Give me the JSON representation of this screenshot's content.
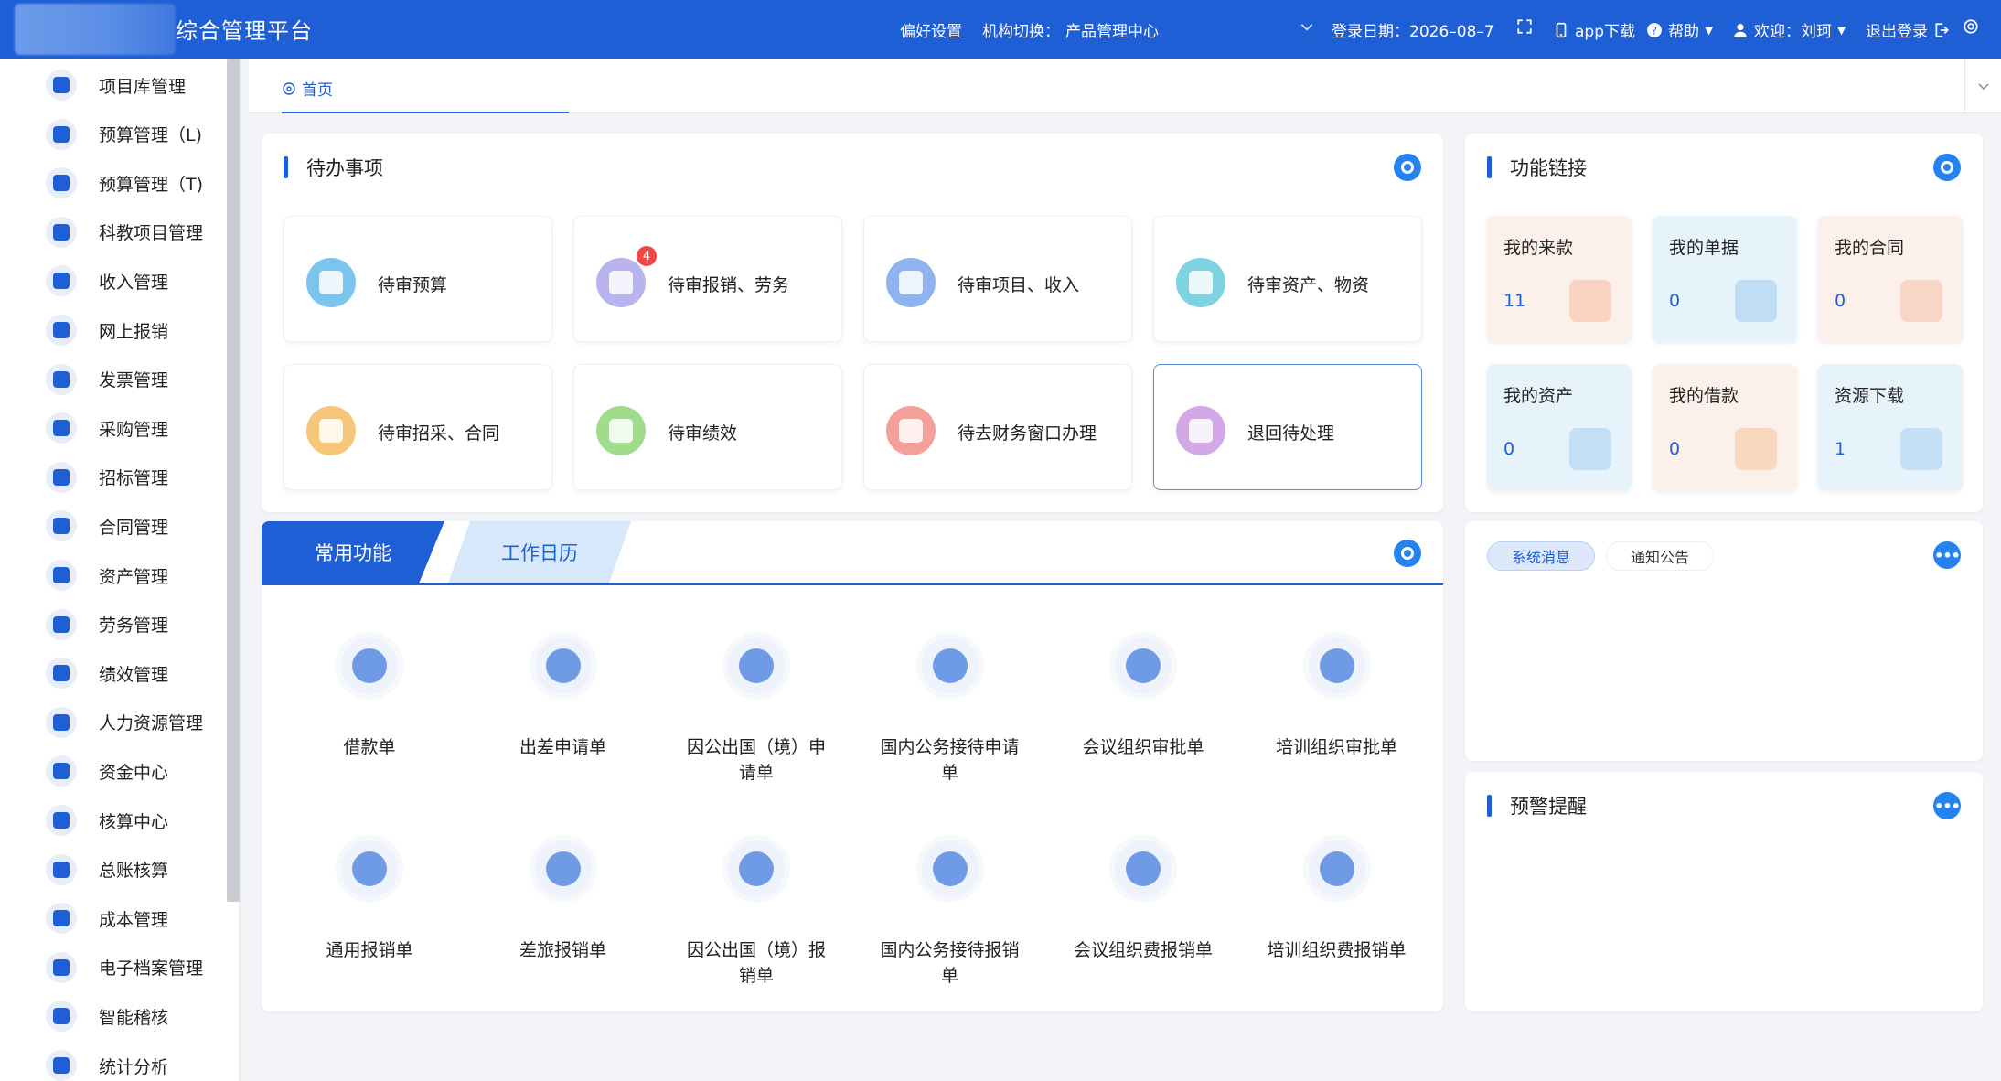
{
  "header": {
    "title": "综合管理平台",
    "preferences": "偏好设置",
    "org_switch_label": "机构切换：",
    "org_name": "产品管理中心",
    "login_date": "登录日期：2026–08–7",
    "app_download": "app下载",
    "help": "帮助",
    "welcome": "欢迎：刘珂",
    "logout": "退出登录"
  },
  "sidebar": {
    "items": [
      {
        "label": "项目库管理"
      },
      {
        "label": "预算管理（L)"
      },
      {
        "label": "预算管理（T)"
      },
      {
        "label": "科教项目管理"
      },
      {
        "label": "收入管理"
      },
      {
        "label": "网上报销"
      },
      {
        "label": "发票管理"
      },
      {
        "label": "采购管理"
      },
      {
        "label": "招标管理"
      },
      {
        "label": "合同管理"
      },
      {
        "label": "资产管理"
      },
      {
        "label": "劳务管理"
      },
      {
        "label": "绩效管理"
      },
      {
        "label": "人力资源管理"
      },
      {
        "label": "资金中心"
      },
      {
        "label": "核算中心"
      },
      {
        "label": "总账核算"
      },
      {
        "label": "成本管理"
      },
      {
        "label": "电子档案管理"
      },
      {
        "label": "智能稽核"
      },
      {
        "label": "统计分析"
      }
    ]
  },
  "tabbar": {
    "home": "首页"
  },
  "todo": {
    "title": "待办事项",
    "items": [
      {
        "label": "待审预算",
        "color": "#7cc4f0"
      },
      {
        "label": "待审报销、劳务",
        "color": "#b9b4ee",
        "badge": "4"
      },
      {
        "label": "待审项目、收入",
        "color": "#8fb3ef"
      },
      {
        "label": "待审资产、物资",
        "color": "#7ed3e0"
      },
      {
        "label": "待审招采、合同",
        "color": "#f5c77a"
      },
      {
        "label": "待审绩效",
        "color": "#9fdc8c"
      },
      {
        "label": "待去财务窗口办理",
        "color": "#f3a09a"
      },
      {
        "label": "退回待处理",
        "color": "#d2a9e6"
      }
    ]
  },
  "links": {
    "title": "功能链接",
    "items": [
      {
        "title": "我的来款",
        "value": "11",
        "bg": "#fbf1ea",
        "deco": "#f6b9a0"
      },
      {
        "title": "我的单据",
        "value": "0",
        "bg": "#e6f3fb",
        "deco": "#9fcaf0"
      },
      {
        "title": "我的合同",
        "value": "0",
        "bg": "#fbf1ea",
        "deco": "#f6c0a6"
      },
      {
        "title": "我的资产",
        "value": "0",
        "bg": "#e6f3fb",
        "deco": "#a6cdf1"
      },
      {
        "title": "我的借款",
        "value": "0",
        "bg": "#fbf1ea",
        "deco": "#f5c49c"
      },
      {
        "title": "资源下载",
        "value": "1",
        "bg": "#e6f3fb",
        "deco": "#a9d0f0"
      }
    ]
  },
  "common": {
    "tab_active": "常用功能",
    "tab_inactive": "工作日历",
    "items": [
      {
        "label": "借款单"
      },
      {
        "label": "出差申请单"
      },
      {
        "label": "因公出国（境）申请单"
      },
      {
        "label": "国内公务接待申请单"
      },
      {
        "label": "会议组织审批单"
      },
      {
        "label": "培训组织审批单"
      },
      {
        "label": "通用报销单"
      },
      {
        "label": "差旅报销单"
      },
      {
        "label": "因公出国（境）报销单"
      },
      {
        "label": "国内公务接待报销单"
      },
      {
        "label": "会议组织费报销单"
      },
      {
        "label": "培训组织费报销单"
      }
    ]
  },
  "messages": {
    "tab_system": "系统消息",
    "tab_notice": "通知公告"
  },
  "alerts": {
    "title": "预警提醒"
  }
}
